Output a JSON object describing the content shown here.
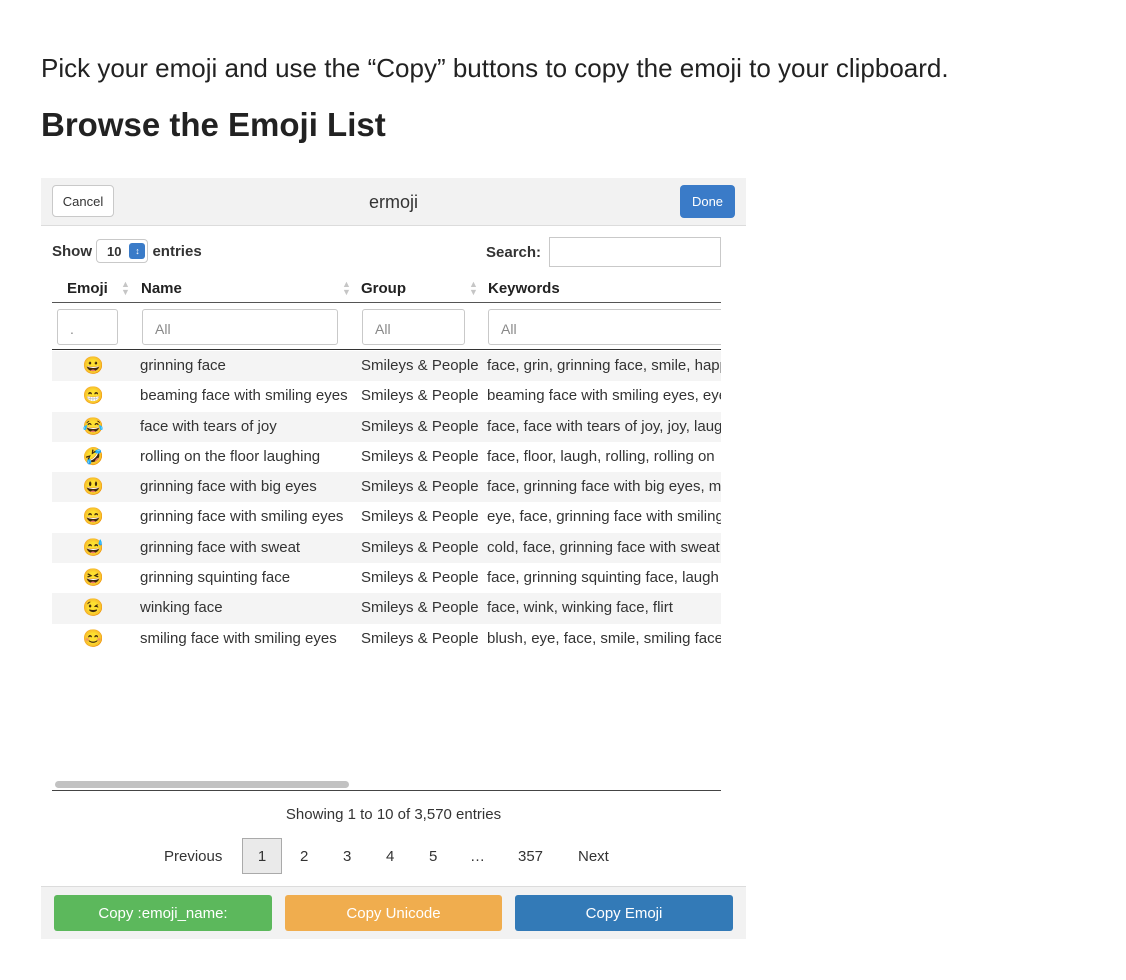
{
  "intro_text": "Pick your emoji and use the “Copy” buttons to copy the emoji to your clipboard.",
  "heading": "Browse the Emoji List",
  "app": {
    "cancel_label": "Cancel",
    "title": "ermoji",
    "done_label": "Done"
  },
  "table_controls": {
    "show_label": "Show",
    "entries_value": "10",
    "entries_label": "entries",
    "search_label": "Search:"
  },
  "columns": {
    "emoji": "Emoji",
    "name": "Name",
    "group": "Group",
    "keywords": "Keywords"
  },
  "filters": {
    "emoji_placeholder": ".",
    "name_placeholder": "All",
    "group_placeholder": "All",
    "keywords_placeholder": "All"
  },
  "rows": [
    {
      "emoji": "😀",
      "name": "grinning face",
      "group": "Smileys & People",
      "keywords": "face, grin, grinning face, smile, happy"
    },
    {
      "emoji": "😁",
      "name": "beaming face with smiling eyes",
      "group": "Smileys & People",
      "keywords": "beaming face with smiling eyes, eye"
    },
    {
      "emoji": "😂",
      "name": "face with tears of joy",
      "group": "Smileys & People",
      "keywords": "face, face with tears of joy, joy, laugh"
    },
    {
      "emoji": "🤣",
      "name": "rolling on the floor laughing",
      "group": "Smileys & People",
      "keywords": "face, floor, laugh, rolling, rolling on"
    },
    {
      "emoji": "😃",
      "name": "grinning face with big eyes",
      "group": "Smileys & People",
      "keywords": "face, grinning face with big eyes, mouth"
    },
    {
      "emoji": "😄",
      "name": "grinning face with smiling eyes",
      "group": "Smileys & People",
      "keywords": "eye, face, grinning face with smiling"
    },
    {
      "emoji": "😅",
      "name": "grinning face with sweat",
      "group": "Smileys & People",
      "keywords": "cold, face, grinning face with sweat"
    },
    {
      "emoji": "😆",
      "name": "grinning squinting face",
      "group": "Smileys & People",
      "keywords": "face, grinning squinting face, laugh"
    },
    {
      "emoji": "😉",
      "name": "winking face",
      "group": "Smileys & People",
      "keywords": "face, wink, winking face, flirt"
    },
    {
      "emoji": "😊",
      "name": "smiling face with smiling eyes",
      "group": "Smileys & People",
      "keywords": "blush, eye, face, smile, smiling face"
    }
  ],
  "info_text": "Showing 1 to 10 of 3,570 entries",
  "pagination": {
    "previous": "Previous",
    "pages": [
      "1",
      "2",
      "3",
      "4",
      "5"
    ],
    "ellipsis": "…",
    "last": "357",
    "next": "Next",
    "current": "1"
  },
  "actions": {
    "copy_name": "Copy :emoji_name:",
    "copy_unicode": "Copy Unicode",
    "copy_emoji": "Copy Emoji"
  }
}
